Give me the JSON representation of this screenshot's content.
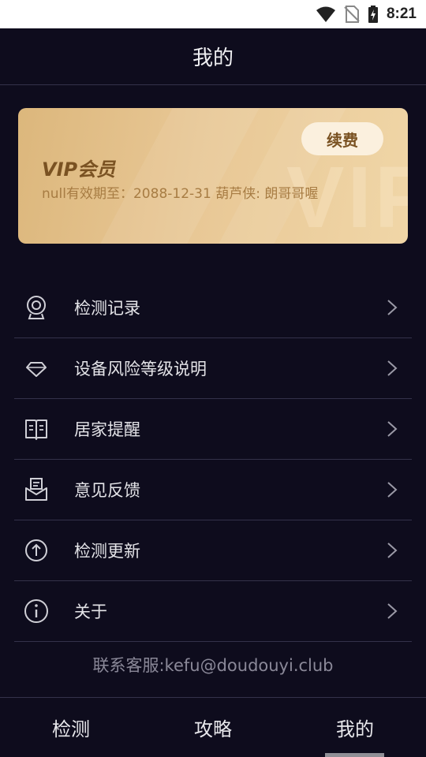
{
  "status_bar": {
    "time": "8:21"
  },
  "header": {
    "title": "我的"
  },
  "vip": {
    "title": "VIP会员",
    "subtitle": "null有效期至：2088-12-31 葫芦侠: 朗哥哥喔",
    "renew_label": "续费",
    "watermark": "VIP"
  },
  "menu": {
    "items": [
      {
        "label": "检测记录",
        "icon": "webcam-icon"
      },
      {
        "label": "设备风险等级说明",
        "icon": "diamond-icon"
      },
      {
        "label": "居家提醒",
        "icon": "book-icon"
      },
      {
        "label": "意见反馈",
        "icon": "feedback-mail-icon"
      },
      {
        "label": "检测更新",
        "icon": "upload-arrow-icon"
      },
      {
        "label": "关于",
        "icon": "info-icon"
      }
    ]
  },
  "contact": "联系客服:kefu@doudouyi.club",
  "nav": {
    "tabs": [
      {
        "label": "检测"
      },
      {
        "label": "攻略"
      },
      {
        "label": "我的"
      }
    ],
    "active_index": 2
  },
  "colors": {
    "background": "#0e0c1d",
    "vip_gold": "#e8c795",
    "vip_text": "#7a5222",
    "divider": "#34324a"
  }
}
